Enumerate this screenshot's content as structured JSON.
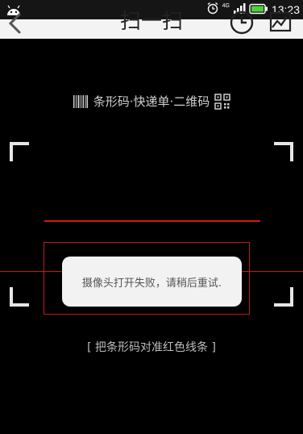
{
  "status_bar": {
    "time": "13:23",
    "network": "4G",
    "icons": [
      "android-icon",
      "alarm-icon",
      "signal-icon",
      "battery-icon"
    ]
  },
  "header": {
    "title": "扫一扫",
    "back_icon": "chevron-left-icon",
    "history_icon": "clock-icon",
    "album_icon": "image-chart-icon"
  },
  "scanner": {
    "hint": "条形码·快递单·二维码",
    "align_hint": "[ 把条形码对准红色线条 ]",
    "laser_color": "#d01818"
  },
  "toast": {
    "message": "摄像头打开失败，请稍后重试."
  }
}
